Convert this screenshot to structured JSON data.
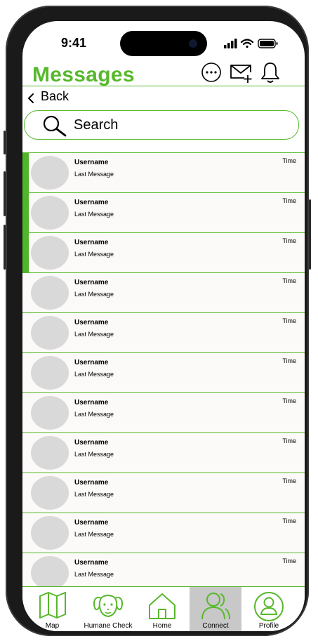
{
  "status_bar": {
    "time": "9:41"
  },
  "header": {
    "title": "Messages",
    "icons": [
      "more-icon",
      "compose-mail-icon",
      "bell-icon"
    ]
  },
  "back": {
    "label": "Back"
  },
  "search": {
    "placeholder": "Search"
  },
  "messages": [
    {
      "username": "Username",
      "last_message": "Last Message",
      "time": "Time",
      "unread": true
    },
    {
      "username": "Username",
      "last_message": "Last Message",
      "time": "Time",
      "unread": true
    },
    {
      "username": "Username",
      "last_message": "Last Message",
      "time": "Time",
      "unread": true
    },
    {
      "username": "Username",
      "last_message": "Last Message",
      "time": "Time",
      "unread": false
    },
    {
      "username": "Username",
      "last_message": "Last Message",
      "time": "Time",
      "unread": false
    },
    {
      "username": "Username",
      "last_message": "Last Message",
      "time": "Time",
      "unread": false
    },
    {
      "username": "Username",
      "last_message": "Last Message",
      "time": "Time",
      "unread": false
    },
    {
      "username": "Username",
      "last_message": "Last Message",
      "time": "Time",
      "unread": false
    },
    {
      "username": "Username",
      "last_message": "Last Message",
      "time": "Time",
      "unread": false
    },
    {
      "username": "Username",
      "last_message": "Last Message",
      "time": "Time",
      "unread": false
    },
    {
      "username": "Username",
      "last_message": "Last Message",
      "time": "Time",
      "unread": false
    }
  ],
  "tabs": [
    {
      "label": "Map",
      "icon": "map-icon",
      "active": false
    },
    {
      "label": "Humane Check",
      "icon": "dog-icon",
      "active": false
    },
    {
      "label": "Home",
      "icon": "home-icon",
      "active": false
    },
    {
      "label": "Connect",
      "icon": "people-icon",
      "active": true
    },
    {
      "label": "Profile",
      "icon": "profile-icon",
      "active": false
    }
  ],
  "colors": {
    "accent": "#57b82b",
    "unread_bar": "#4fb52a",
    "row_bg": "#fcfaf9",
    "avatar": "#d9d9d9",
    "active_tab": "#c8c8c8"
  }
}
